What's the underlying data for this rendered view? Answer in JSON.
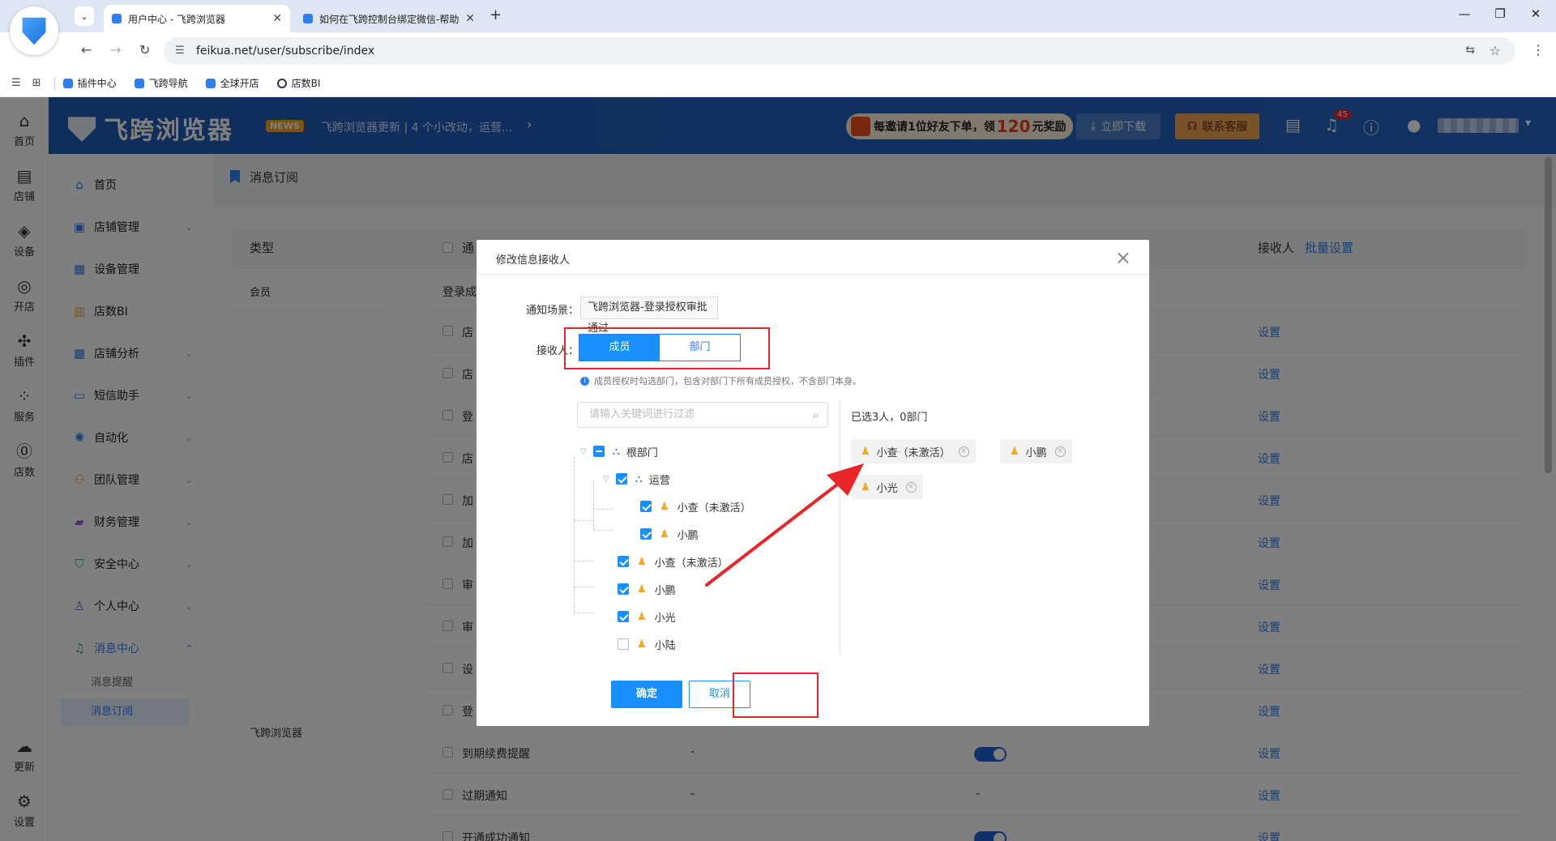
{
  "browser": {
    "tabs": [
      {
        "title": "用户中心 - 飞跨浏览器",
        "active": true
      },
      {
        "title": "如何在飞跨控制台绑定微信-帮助",
        "active": false
      }
    ],
    "url": "feikua.net/user/subscribe/index",
    "bookmarks": [
      "插件中心",
      "飞跨导航",
      "全球开店",
      "店数BI"
    ]
  },
  "rail": {
    "items": [
      {
        "label": "首页",
        "icon": "home-icon",
        "glyph": "⌂"
      },
      {
        "label": "店铺",
        "icon": "store-icon",
        "glyph": "▤"
      },
      {
        "label": "设备",
        "icon": "layers-icon",
        "glyph": "◈"
      },
      {
        "label": "开店",
        "icon": "planet-icon",
        "glyph": "◎"
      },
      {
        "label": "插件",
        "icon": "puzzle-icon",
        "glyph": "✣"
      },
      {
        "label": "服务",
        "icon": "grid-icon",
        "glyph": "⁘"
      },
      {
        "label": "店数",
        "icon": "bi-icon",
        "glyph": "⓪"
      }
    ],
    "bottom": [
      {
        "label": "更新",
        "icon": "cloud-upload-icon",
        "glyph": "☁"
      },
      {
        "label": "设置",
        "icon": "settings-icon",
        "glyph": "⚙"
      }
    ]
  },
  "header": {
    "brand": "飞跨浏览器",
    "news_badge": "NEWS",
    "news_text": "飞跨浏览器更新 | 4 个小改动，运营...",
    "invite": {
      "pre": "每邀请1位好友下单，领",
      "amount": "120",
      "post": "元奖励"
    },
    "download_label": "立即下载",
    "service_label": "联系客服",
    "notification_count": "45"
  },
  "side_menu": {
    "items": [
      {
        "label": "首页",
        "icon": "home-icon",
        "glyph": "⌂",
        "expandable": false
      },
      {
        "label": "店铺管理",
        "icon": "store-icon",
        "glyph": "▣",
        "expandable": true
      },
      {
        "label": "设备管理",
        "icon": "device-icon",
        "glyph": "▦",
        "expandable": false
      },
      {
        "label": "店数BI",
        "icon": "chart-icon",
        "glyph": "▥",
        "expandable": false
      },
      {
        "label": "店铺分析",
        "icon": "analysis-icon",
        "glyph": "▩",
        "expandable": true
      },
      {
        "label": "短信助手",
        "icon": "sms-icon",
        "glyph": "▭",
        "expandable": true
      },
      {
        "label": "自动化",
        "icon": "automation-icon",
        "glyph": "✺",
        "expandable": true
      },
      {
        "label": "团队管理",
        "icon": "team-icon",
        "glyph": "⚇",
        "expandable": true
      },
      {
        "label": "财务管理",
        "icon": "wallet-icon",
        "glyph": "▰",
        "expandable": true
      },
      {
        "label": "安全中心",
        "icon": "shield-icon",
        "glyph": "⛉",
        "expandable": true
      },
      {
        "label": "个人中心",
        "icon": "user-icon",
        "glyph": "♙",
        "expandable": true
      },
      {
        "label": "消息中心",
        "icon": "bell-icon",
        "glyph": "♫",
        "expandable": true,
        "open": true
      }
    ],
    "sub_items": [
      {
        "label": "消息提醒",
        "active": false
      },
      {
        "label": "消息订阅",
        "active": true
      }
    ]
  },
  "breadcrumb": "消息订阅",
  "table": {
    "headers": {
      "type": "类型",
      "notify_partial": "通",
      "receiver": "接收人",
      "batch": "批量设置"
    },
    "groups": [
      {
        "label": "会员"
      },
      {
        "label": "飞跨浏览器"
      }
    ],
    "rows": [
      {
        "name": "登录成",
        "link": ""
      },
      {
        "name": "店",
        "link": "设置"
      },
      {
        "name": "店",
        "link": "设置"
      },
      {
        "name": "登",
        "link": "设置"
      },
      {
        "name": "店",
        "link": "设置"
      },
      {
        "name": "加",
        "link": "设置"
      },
      {
        "name": "加",
        "link": "设置"
      },
      {
        "name": "审",
        "link": "设置"
      },
      {
        "name": "审",
        "link": "设置"
      },
      {
        "name": "设",
        "link": "设置"
      },
      {
        "name": "登",
        "link": "设置"
      },
      {
        "name": "到期续费提醒",
        "col2": "-",
        "toggle": true,
        "link": "设置"
      },
      {
        "name": "过期通知",
        "col2": "-",
        "col3": "-",
        "link": "设置"
      },
      {
        "name": "开通成功通知",
        "toggle": true,
        "link": "设置"
      }
    ]
  },
  "modal": {
    "title": "修改信息接收人",
    "scene_label": "通知场景：",
    "scene_value": "飞跨浏览器-登录授权审批通过",
    "receiver_label": "接收人：",
    "segments": [
      {
        "label": "成员",
        "selected": true
      },
      {
        "label": "部门",
        "selected": false
      }
    ],
    "hint": "成员授权时勾选部门，包含对部门下所有成员授权，不含部门本身。",
    "filter_placeholder": "请输入关键词进行过滤",
    "tree": [
      {
        "label": "根部门",
        "type": "dept",
        "state": "partial"
      },
      {
        "label": "运营",
        "type": "dept",
        "state": "checked"
      },
      {
        "label": "小查（未激活）",
        "type": "person",
        "state": "checked"
      },
      {
        "label": "小鹏",
        "type": "person",
        "state": "checked"
      },
      {
        "label": "小查（未激活）",
        "type": "person",
        "state": "checked"
      },
      {
        "label": "小鹏",
        "type": "person",
        "state": "checked"
      },
      {
        "label": "小光",
        "type": "person",
        "state": "checked"
      },
      {
        "label": "小陆",
        "type": "person",
        "state": "unchecked"
      }
    ],
    "selected_summary": "已选3人，0部门",
    "chips": [
      "小查（未激活）",
      "小鹏",
      "小光"
    ],
    "confirm_label": "确定",
    "cancel_label": "取消"
  },
  "colors": {
    "primary": "#1890ff",
    "header_blue": "#2565c6",
    "annotation_red": "#e8262a",
    "person_orange": "#f5a623"
  }
}
